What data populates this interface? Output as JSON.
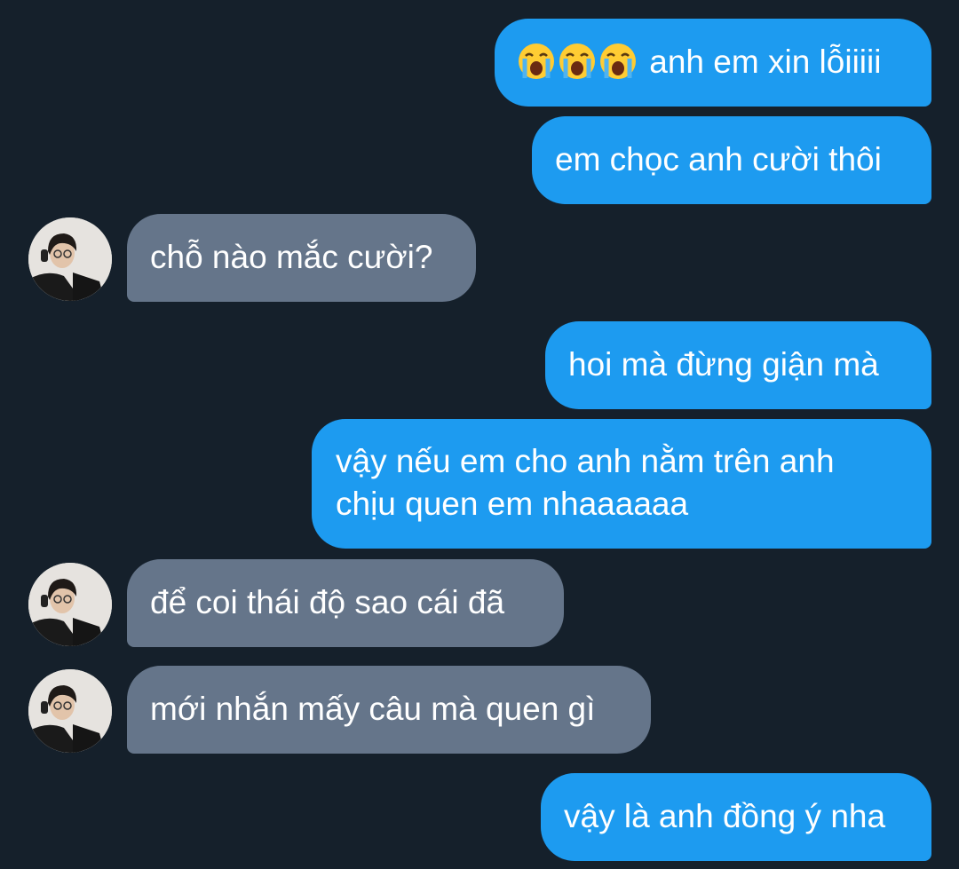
{
  "theme": {
    "background": "#15202b",
    "outgoing_color": "#1d9bf0",
    "incoming_color": "#65758a",
    "text_color": "#ffffff"
  },
  "messages": [
    {
      "direction": "outgoing",
      "emoji": [
        "loudly-crying-face",
        "loudly-crying-face",
        "loudly-crying-face"
      ],
      "text": "anh em xin lỗiiiii"
    },
    {
      "direction": "outgoing",
      "text": "em chọc anh cười thôi"
    },
    {
      "direction": "incoming",
      "avatar": "sender-avatar",
      "text": "chỗ nào mắc cười?"
    },
    {
      "direction": "outgoing",
      "text": "hoi mà đừng giận mà"
    },
    {
      "direction": "outgoing",
      "lines": [
        "vậy nếu em cho anh nằm trên anh",
        "chịu quen em nhaaaaaa"
      ]
    },
    {
      "direction": "incoming",
      "avatar": "sender-avatar",
      "text": "để coi thái độ sao cái đã"
    },
    {
      "direction": "incoming",
      "avatar": "sender-avatar",
      "text": "mới nhắn mấy câu mà quen gì"
    },
    {
      "direction": "outgoing",
      "text": "vậy là anh đồng ý nha"
    }
  ]
}
